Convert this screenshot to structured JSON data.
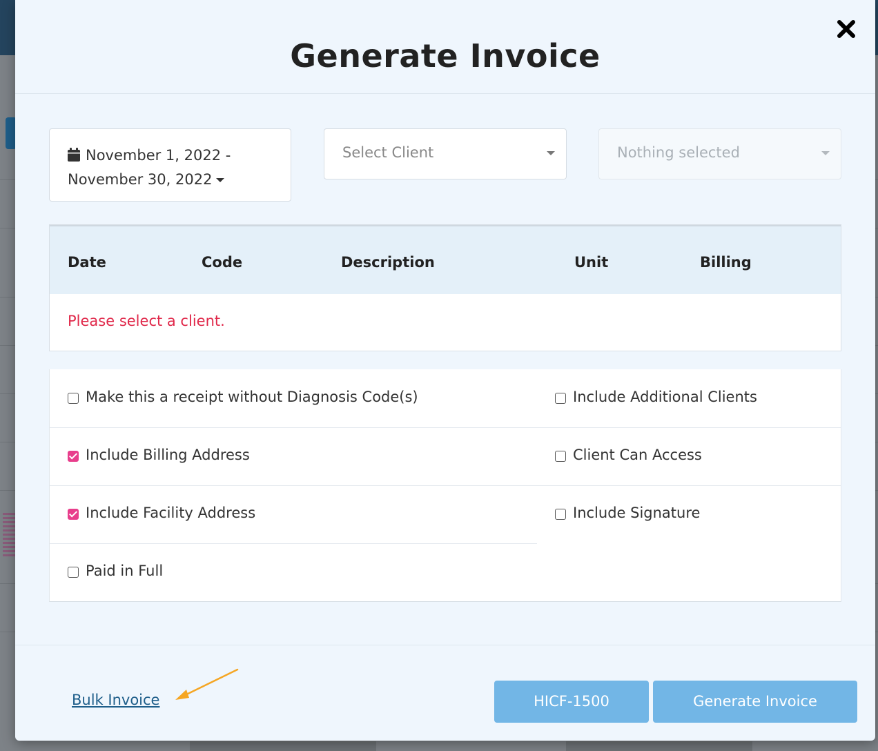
{
  "modal": {
    "title": "Generate Invoice",
    "close_icon": "close-icon"
  },
  "filters": {
    "date_range_line1": "November 1, 2022 -",
    "date_range_line2": "November 30, 2022",
    "date_icon": "calendar-icon",
    "client_select_placeholder": "Select Client",
    "secondary_select_placeholder": "Nothing selected"
  },
  "table": {
    "columns": [
      "Date",
      "Code",
      "Description",
      "Unit",
      "Billing"
    ],
    "empty_message": "Please select a client."
  },
  "options": [
    {
      "label": "Make this a receipt without Diagnosis Code(s)",
      "checked": false
    },
    {
      "label": "Include Additional Clients",
      "checked": false
    },
    {
      "label": "Include Billing Address",
      "checked": true
    },
    {
      "label": "Client Can Access",
      "checked": false
    },
    {
      "label": "Include Facility Address",
      "checked": true
    },
    {
      "label": "Include Signature",
      "checked": false
    },
    {
      "label": "Paid in Full",
      "checked": false
    }
  ],
  "footer": {
    "bulk_invoice_link": "Bulk Invoice",
    "hicf_button": "HICF-1500",
    "generate_button": "Generate Invoice"
  },
  "colors": {
    "checkbox_checked": "#e83e8c",
    "error_text": "#e0284a",
    "primary_button": "#72b6e6",
    "link": "#1e5e8a",
    "annotation_arrow": "#f5a623"
  }
}
